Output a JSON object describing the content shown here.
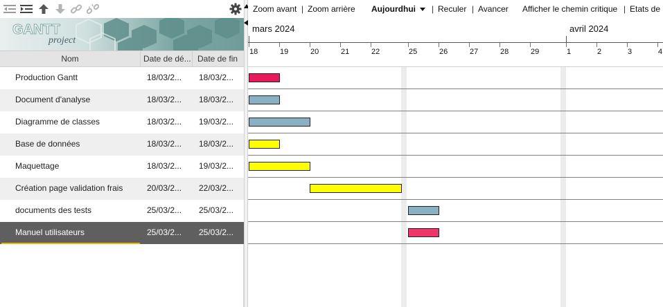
{
  "toolbar": {
    "icons": [
      "unindent-icon",
      "indent-icon",
      "move-up-icon",
      "move-down-icon",
      "link-icon",
      "unlink-icon",
      "settings-gear-icon"
    ]
  },
  "logo": {
    "brand": "GANTT",
    "sub": "project"
  },
  "columns": {
    "name": "Nom",
    "start": "Date de dé...",
    "end": "Date de fin"
  },
  "tasks": [
    {
      "name": "Production Gantt",
      "start": "18/03/2...",
      "end": "18/03/2...",
      "color": "#e8185a",
      "day_start": 0,
      "days": 1
    },
    {
      "name": "Document d'analyse",
      "start": "18/03/2...",
      "end": "18/03/2...",
      "color": "#8ab0c6",
      "day_start": 0,
      "days": 1
    },
    {
      "name": "Diagramme de classes",
      "start": "18/03/2...",
      "end": "19/03/2...",
      "color": "#8ab0c6",
      "day_start": 0,
      "days": 2
    },
    {
      "name": "Base de données",
      "start": "18/03/2...",
      "end": "18/03/2...",
      "color": "#ffff00",
      "day_start": 0,
      "days": 1
    },
    {
      "name": "Maquettage",
      "start": "18/03/2...",
      "end": "19/03/2...",
      "color": "#ffff00",
      "day_start": 0,
      "days": 2
    },
    {
      "name": "Création page validation frais",
      "start": "20/03/2...",
      "end": "22/03/2...",
      "color": "#ffff00",
      "day_start": 2,
      "days": 3
    },
    {
      "name": "documents des tests",
      "start": "25/03/2...",
      "end": "25/03/2...",
      "color": "#8ab0c6",
      "day_start": 5,
      "days": 1
    },
    {
      "name": "Manuel utilisateurs",
      "start": "25/03/2...",
      "end": "25/03/2...",
      "color": "#f0356a",
      "day_start": 5,
      "days": 1,
      "selected": true
    }
  ],
  "chart_toolbar": {
    "zoom_in": "Zoom avant",
    "zoom_out": "Zoom arrière",
    "today": "Aujourdhui",
    "back": "Reculer",
    "forward": "Avancer",
    "critical": "Afficher le chemin critique",
    "states": "Etats de"
  },
  "timeline": {
    "months": [
      {
        "label": "mars 2024"
      },
      {
        "label": "avril 2024"
      }
    ],
    "days": [
      "18",
      "19",
      "20",
      "21",
      "22",
      "25",
      "26",
      "27",
      "28",
      "29",
      "1",
      "2",
      "3",
      "4"
    ]
  }
}
